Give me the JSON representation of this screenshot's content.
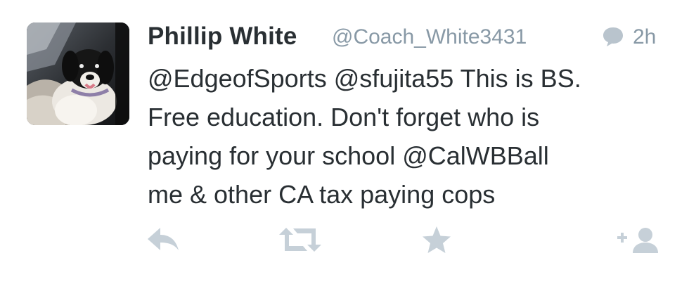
{
  "tweet": {
    "author": {
      "name": "Phillip White",
      "handle": "@Coach_White3431",
      "avatar_icon": "profile-photo-dog"
    },
    "meta": {
      "conversation_icon": "chat-bubble-icon",
      "time": "2h"
    },
    "text_lines": [
      "@EdgeofSports @sfujita55 This is BS.",
      "Free education. Don't forget who is",
      "paying for your school @CalWBBall",
      "me & other CA tax paying cops"
    ],
    "actions": {
      "reply_icon": "reply-arrow-icon",
      "retweet_icon": "retweet-icon",
      "favorite_icon": "star-icon",
      "follow_icon": "add-user-icon"
    }
  },
  "colors": {
    "text": "#292f33",
    "muted": "#8899a6",
    "action_icon": "#c6d0d8",
    "background": "#ffffff"
  }
}
